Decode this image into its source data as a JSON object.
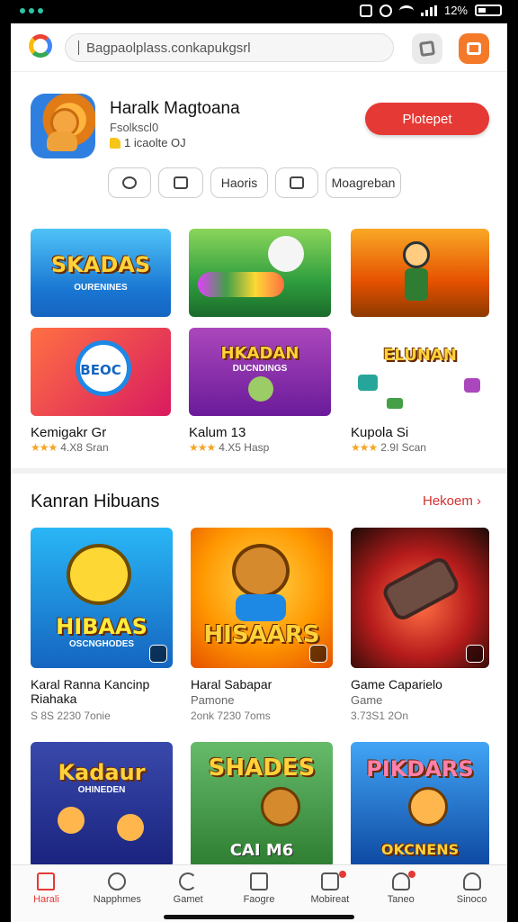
{
  "status": {
    "battery": "12%"
  },
  "search": {
    "query": "Bagpaolplass.conkapukgsrl"
  },
  "app": {
    "title": "Haralk Magtoana",
    "subtitle": "Fsolkscl0",
    "rating": "1 icaolte OJ",
    "install_label": "Plotepet"
  },
  "chips": [
    "",
    "",
    "Haoris",
    "",
    "Moagreban"
  ],
  "top_tiles": [
    {
      "text": "SKADAS",
      "sub": "OURENINES"
    },
    {
      "text": "",
      "sub": ""
    },
    {
      "text": "",
      "sub": ""
    },
    {
      "text": "BEOC",
      "sub": ""
    },
    {
      "text": "HKADAN",
      "sub": "DUCNDINGS"
    },
    {
      "text": "ELUNAN",
      "sub": ""
    }
  ],
  "top_labels": [
    {
      "name": "Kemigakr Gr",
      "meta": "4.X8 Sran"
    },
    {
      "name": "Kalum 13",
      "meta": "4.X5 Hasp"
    },
    {
      "name": "Kupola Si",
      "meta": "2.9I Scan"
    }
  ],
  "section": {
    "title": "Kanran Hibuans",
    "link": "Hekoem"
  },
  "cards": [
    {
      "art_title": "HIBAAS",
      "art_sub": "OSCNGHODES",
      "title": "Karal Ranna Kancinp Riahaka",
      "sub": "",
      "meta": "S 8S 2230 7onie"
    },
    {
      "art_title": "HISAARS",
      "art_sub": "",
      "title": "Haral Sabapar",
      "sub": "Pamone",
      "meta": "2onk 7230 7oms"
    },
    {
      "art_title": "",
      "art_sub": "",
      "title": "Game Caparielo",
      "sub": "Game",
      "meta": "3.73S1 2On"
    },
    {
      "art_title": "Kadaur",
      "art_sub": "OHINEDEN",
      "title": "",
      "sub": "",
      "meta": ""
    },
    {
      "art_title": "SHADES",
      "art_sub": "CAI M6",
      "title": "",
      "sub": "",
      "meta": ""
    },
    {
      "art_title": "PIKDARS",
      "art_sub": "OKCNENS",
      "title": "",
      "sub": "",
      "meta": ""
    }
  ],
  "nav": [
    {
      "label": "Harali",
      "active": true
    },
    {
      "label": "Napphmes"
    },
    {
      "label": "Gamet"
    },
    {
      "label": "Faogre"
    },
    {
      "label": "Mobireat"
    },
    {
      "label": "Taneo"
    },
    {
      "label": "Sinoco"
    }
  ],
  "colors": {
    "accent": "#e53935",
    "link": "#d32f2f",
    "stars": "#f5a623"
  }
}
